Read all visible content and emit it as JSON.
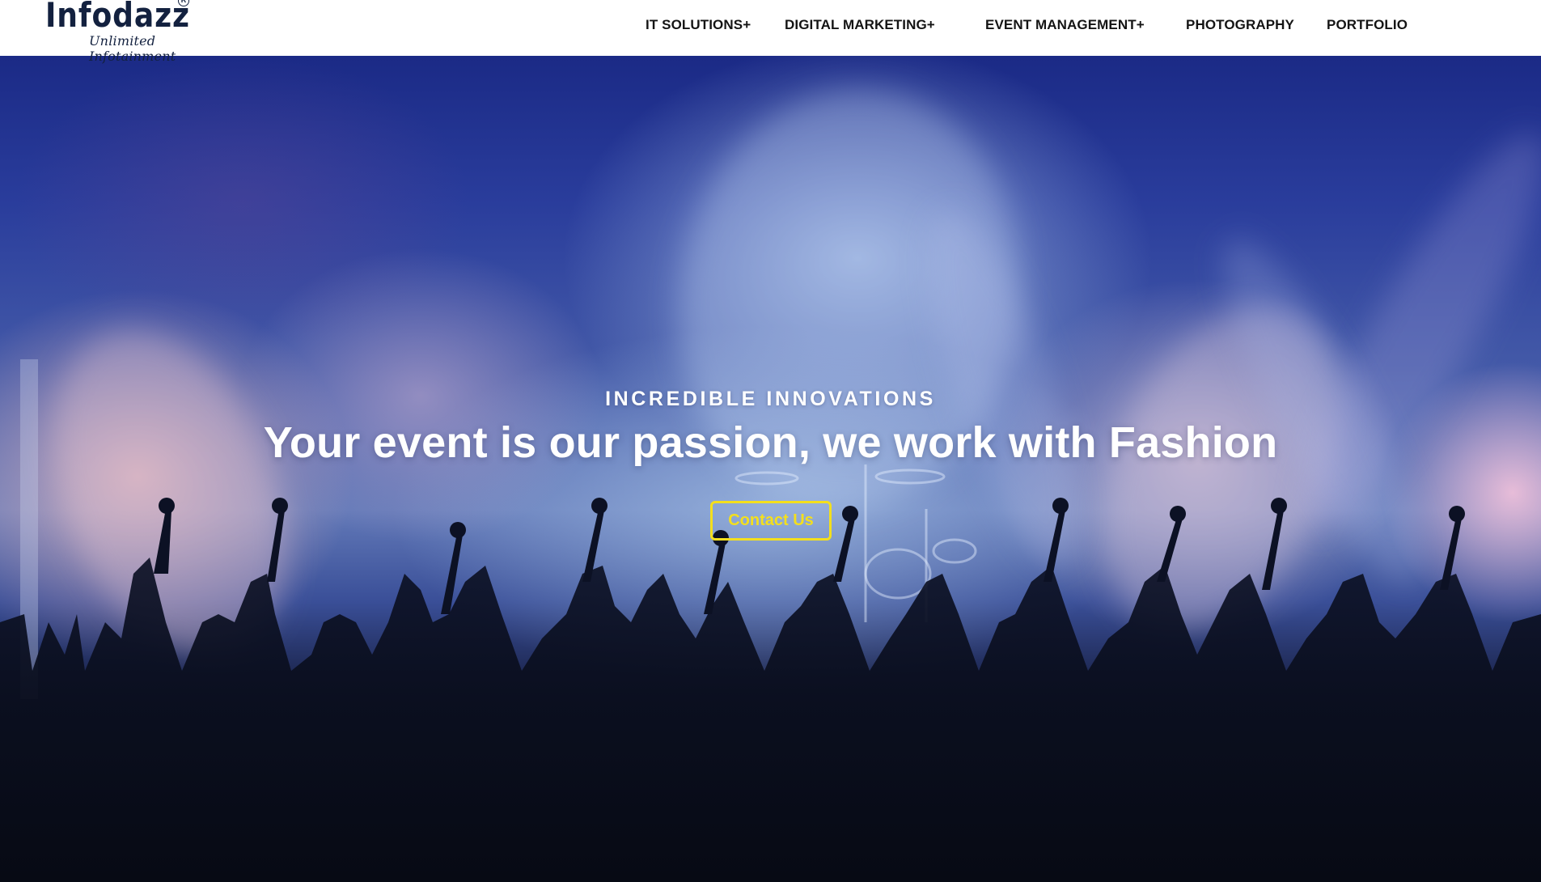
{
  "header": {
    "logo": {
      "wordmark": "Infodazz",
      "registered": "R",
      "tagline": "Unlimited Infotainment"
    },
    "nav": [
      {
        "label": "IT SOLUTIONS+"
      },
      {
        "label": "DIGITAL MARKETING+"
      },
      {
        "label": "EVENT MANAGEMENT+"
      },
      {
        "label": "PHOTOGRAPHY"
      },
      {
        "label": "PORTFOLIO"
      }
    ]
  },
  "hero": {
    "kicker": "INCREDIBLE INNOVATIONS",
    "headline": "Your event is our passion, we work with Fashion",
    "cta_label": "Contact Us",
    "background": "concert-crowd-stage-lights"
  },
  "colors": {
    "accent": "#f3df1d",
    "logo": "#13213f",
    "nav_text": "#141414",
    "hero_text": "#ffffff"
  }
}
